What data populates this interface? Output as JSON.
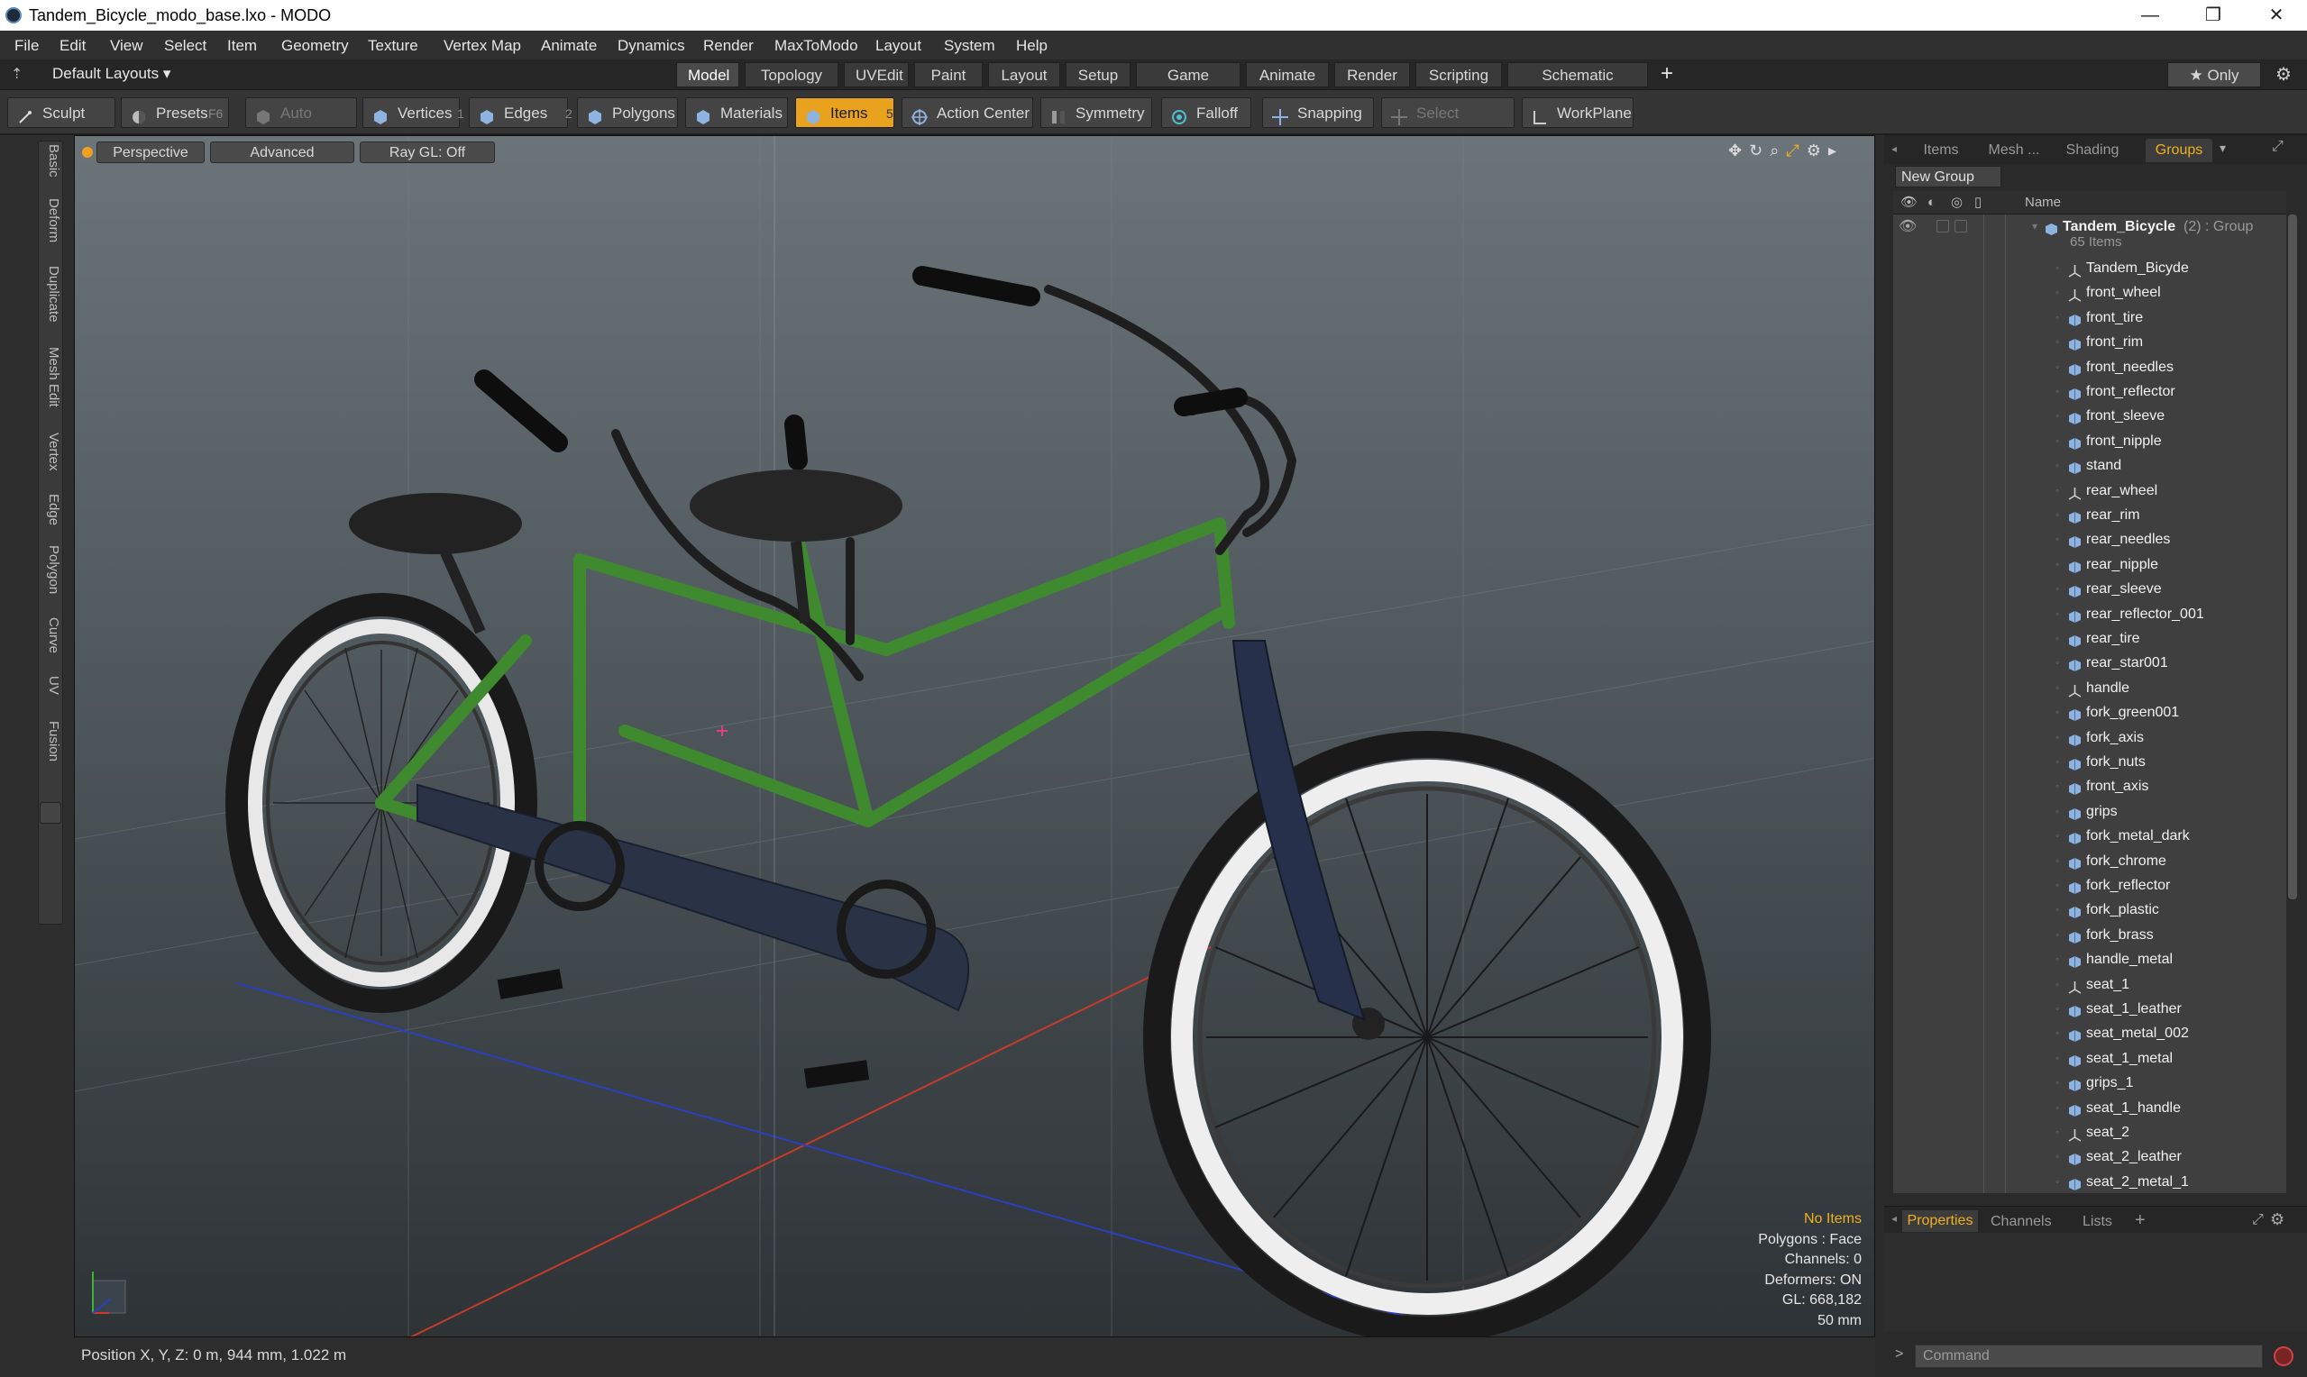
{
  "window": {
    "title": "Tandem_Bicycle_modo_base.lxo - MODO",
    "min_icon": "minimize-icon",
    "max_icon": "restore-icon",
    "close_icon": "close-icon",
    "min_glyph": "—",
    "max_glyph": "❐",
    "close_glyph": "✕"
  },
  "menu": [
    "File",
    "Edit",
    "View",
    "Select",
    "Item",
    "Geometry",
    "Texture",
    "Vertex Map",
    "Animate",
    "Dynamics",
    "Render",
    "MaxToModo",
    "Layout",
    "System",
    "Help"
  ],
  "layoutbar": {
    "layout_dropdown": "Default Layouts ▾",
    "tabs": [
      "Model",
      "Topology",
      "UVEdit",
      "Paint",
      "Layout",
      "Setup",
      "Game Tools",
      "Animate",
      "Render",
      "Scripting",
      "Schematic Fusion"
    ],
    "active_tab": "Model",
    "add_label": "+",
    "only_label": "★  Only"
  },
  "toolbar": {
    "sculpt": "Sculpt",
    "presets": "Presets",
    "presets_key": "F6",
    "auto_select": "Auto Select",
    "vertices": "Vertices",
    "vertices_count": "1",
    "edges": "Edges",
    "edges_count": "2",
    "polygons": "Polygons",
    "materials": "Materials",
    "items": "Items",
    "items_count": "5",
    "action_center": "Action Center",
    "symmetry": "Symmetry",
    "falloff": "Falloff",
    "snapping": "Snapping",
    "select_through": "Select Through",
    "workplane": "WorkPlane"
  },
  "left_tabs": [
    "Basic",
    "Deform",
    "Duplicate",
    "Mesh Edit",
    "Vertex",
    "Edge",
    "Polygon",
    "Curve",
    "UV",
    "Fusion"
  ],
  "viewport": {
    "perspective": "Perspective",
    "advanced": "Advanced",
    "raygl": "Ray GL: Off",
    "info": {
      "no_items": "No Items",
      "polygons": "Polygons : Face",
      "channels": "Channels: 0",
      "deformers": "Deformers: ON",
      "gl": "GL: 668,182",
      "focal": "50 mm"
    }
  },
  "status": {
    "position": "Position X, Y, Z:   0 m, 944 mm, 1.022 m"
  },
  "right_panel": {
    "tabs": [
      "Items",
      "Mesh ...",
      "Shading",
      "Groups"
    ],
    "active_tab": "Groups",
    "new_group": "New Group",
    "col_name": "Name",
    "group_name": "Tandem_Bicycle",
    "group_suffix": "(2) : Group",
    "group_count": "65 Items",
    "items": [
      {
        "name": "Tandem_Bicyde",
        "type": "locator"
      },
      {
        "name": "front_wheel",
        "type": "locator"
      },
      {
        "name": "front_tire",
        "type": "mesh"
      },
      {
        "name": "front_rim",
        "type": "mesh"
      },
      {
        "name": "front_needles",
        "type": "mesh"
      },
      {
        "name": "front_reflector",
        "type": "mesh"
      },
      {
        "name": "front_sleeve",
        "type": "mesh"
      },
      {
        "name": "front_nipple",
        "type": "mesh"
      },
      {
        "name": "stand",
        "type": "mesh"
      },
      {
        "name": "rear_wheel",
        "type": "locator"
      },
      {
        "name": "rear_rim",
        "type": "mesh"
      },
      {
        "name": "rear_needles",
        "type": "mesh"
      },
      {
        "name": "rear_nipple",
        "type": "mesh"
      },
      {
        "name": "rear_sleeve",
        "type": "mesh"
      },
      {
        "name": "rear_reflector_001",
        "type": "mesh"
      },
      {
        "name": "rear_tire",
        "type": "mesh"
      },
      {
        "name": "rear_star001",
        "type": "mesh"
      },
      {
        "name": "handle",
        "type": "locator"
      },
      {
        "name": "fork_green001",
        "type": "mesh"
      },
      {
        "name": "fork_axis",
        "type": "mesh"
      },
      {
        "name": "fork_nuts",
        "type": "mesh"
      },
      {
        "name": "front_axis",
        "type": "mesh"
      },
      {
        "name": "grips",
        "type": "mesh"
      },
      {
        "name": "fork_metal_dark",
        "type": "mesh"
      },
      {
        "name": "fork_chrome",
        "type": "mesh"
      },
      {
        "name": "fork_reflector",
        "type": "mesh"
      },
      {
        "name": "fork_plastic",
        "type": "mesh"
      },
      {
        "name": "fork_brass",
        "type": "mesh"
      },
      {
        "name": "handle_metal",
        "type": "mesh"
      },
      {
        "name": "seat_1",
        "type": "locator"
      },
      {
        "name": "seat_1_leather",
        "type": "mesh"
      },
      {
        "name": "seat_metal_002",
        "type": "mesh"
      },
      {
        "name": "seat_1_metal",
        "type": "mesh"
      },
      {
        "name": "grips_1",
        "type": "mesh"
      },
      {
        "name": "seat_1_handle",
        "type": "mesh"
      },
      {
        "name": "seat_2",
        "type": "locator"
      },
      {
        "name": "seat_2_leather",
        "type": "mesh"
      },
      {
        "name": "seat_2_metal_1",
        "type": "mesh"
      }
    ],
    "bottom_tabs": [
      "Properties",
      "Channels",
      "Lists",
      "+"
    ],
    "bottom_active": "Properties",
    "command_placeholder": "Command",
    "prompt": ">"
  },
  "colors": {
    "accent": "#e8a21d",
    "frame_green": "#3f8a2f",
    "chainguard": "#2a3346",
    "axis_x": "#c83a2a",
    "axis_z": "#2c3fc0"
  }
}
